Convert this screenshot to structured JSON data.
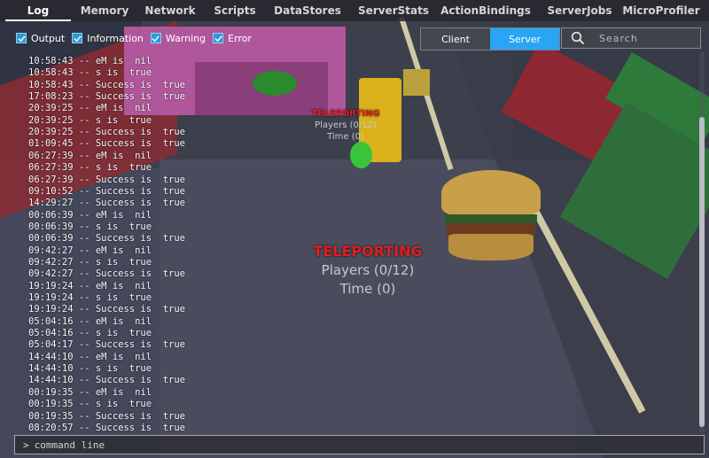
{
  "tabs": [
    {
      "label": "Log",
      "active": true
    },
    {
      "label": "Memory"
    },
    {
      "label": "Network"
    },
    {
      "label": "Scripts"
    },
    {
      "label": "DataStores"
    },
    {
      "label": "ServerStats"
    },
    {
      "label": "ActionBindings"
    },
    {
      "label": "ServerJobs"
    },
    {
      "label": "MicroProfiler"
    }
  ],
  "filters": [
    {
      "label": "Output",
      "checked": true
    },
    {
      "label": "Information",
      "checked": true
    },
    {
      "label": "Warning",
      "checked": true
    },
    {
      "label": "Error",
      "checked": true
    }
  ],
  "view_toggle": {
    "client_label": "Client",
    "server_label": "Server",
    "selected": "Server"
  },
  "search": {
    "placeholder": "Search",
    "icon": "search-icon"
  },
  "log_lines": [
    "10:58:43 -- eM is  nil",
    "10:58:43 -- s is  true",
    "10:58:43 -- Success is  true",
    "17:08:23 -- Success is  true",
    "20:39:25 -- eM is  nil",
    "20:39:25 -- s is  true",
    "20:39:25 -- Success is  true",
    "01:09:45 -- Success is  true",
    "06:27:39 -- eM is  nil",
    "06:27:39 -- s is  true",
    "06:27:39 -- Success is  true",
    "09:10:52 -- Success is  true",
    "14:29:27 -- Success is  true",
    "00:06:39 -- eM is  nil",
    "00:06:39 -- s is  true",
    "00:06:39 -- Success is  true",
    "09:42:27 -- eM is  nil",
    "09:42:27 -- s is  true",
    "09:42:27 -- Success is  true",
    "19:19:24 -- eM is  nil",
    "19:19:24 -- s is  true",
    "19:19:24 -- Success is  true",
    "05:04:16 -- eM is  nil",
    "05:04:16 -- s is  true",
    "05:04:17 -- Success is  true",
    "14:44:10 -- eM is  nil",
    "14:44:10 -- s is  true",
    "14:44:10 -- Success is  true",
    "00:19:35 -- eM is  nil",
    "00:19:35 -- s is  true",
    "00:19:35 -- Success is  true",
    "08:20:57 -- Success is  true"
  ],
  "command_line": {
    "prompt": ">",
    "placeholder": "command line"
  },
  "scene": {
    "teleport_title": "TELEPORTING",
    "players": "Players (0/12)",
    "time": "Time (0)"
  },
  "colors": {
    "accent": "#2aa4f4",
    "checkbox": "#2d9ad6",
    "teleport_red": "#e01f1f"
  }
}
